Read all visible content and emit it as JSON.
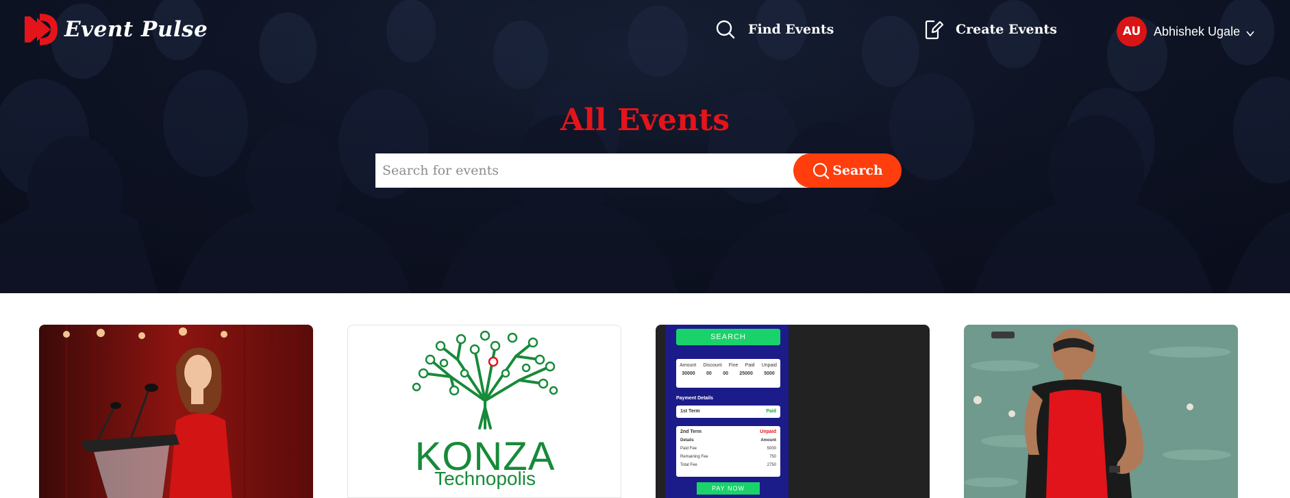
{
  "brand": {
    "name": "Event Pulse",
    "logo_icon": "double-play-logo-icon"
  },
  "nav": {
    "find_label": "Find Events",
    "create_label": "Create Events",
    "user_initials": "AU",
    "user_name": "Abhishek Ugale"
  },
  "hero": {
    "title": "All Events",
    "search_placeholder": "Search for events",
    "search_button_label": "Search"
  },
  "colors": {
    "accent": "#ff3d0d",
    "headline_red": "#e5141a",
    "avatar_red": "#d91414",
    "konza_green": "#178a3a"
  },
  "cards": [
    {
      "image": "woman-speaking-at-podium"
    },
    {
      "image": "konza-technopolis-logo",
      "logo_title": "KONZA",
      "logo_subtitle": "Technopolis"
    },
    {
      "image": "payment-app-mockup",
      "mockup": {
        "search_label": "SEARCH",
        "headers": [
          "Amount",
          "Discount",
          "Fine",
          "Paid",
          "Unpaid"
        ],
        "values": [
          "30000",
          "00",
          "00",
          "25000",
          "5000"
        ],
        "payment_details_label": "Payment Details",
        "term1_label": "1st Term",
        "term1_status": "Paid",
        "term2_label": "2nd Term",
        "term2_status": "Unpaid",
        "details_label": "Details",
        "amount_label": "Amount",
        "lines": [
          {
            "label": "Paid Fee",
            "value": "5000"
          },
          {
            "label": "Remaining Fee",
            "value": "750"
          },
          {
            "label": "Total Fee",
            "value": "2750"
          }
        ],
        "pay_now_label": "PAY NOW"
      }
    },
    {
      "image": "triathlete-in-red-wetsuit"
    }
  ]
}
